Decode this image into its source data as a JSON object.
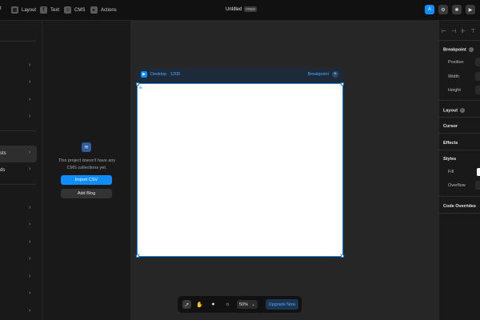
{
  "topbar": {
    "left_cut": "t",
    "items": [
      {
        "label": "Layout",
        "icon": "layout-icon"
      },
      {
        "label": "Text",
        "icon": "text-icon"
      },
      {
        "label": "CMS",
        "icon": "cms-icon"
      },
      {
        "label": "Actions",
        "icon": "actions-icon"
      }
    ],
    "title": "Untitled",
    "plan_badge": "FREE",
    "avatar_initial": "A",
    "accent": "#0f8cff"
  },
  "leftnav": {
    "active_item": "sts",
    "second_item": "ds"
  },
  "cms": {
    "empty_message": "This project doesn't have any CMS collections yet.",
    "import_label": "Import CSV",
    "add_blog_label": "Add Blog"
  },
  "canvas": {
    "frame_label": "Desktop",
    "frame_width": "1200",
    "breakpoint_label": "Breakpoint",
    "plus": "+"
  },
  "bottombar": {
    "zoom": "50%",
    "upgrade_label": "Upgrade Now"
  },
  "inspector": {
    "breakpoint": "Breakpoint",
    "position": "Position",
    "width": "Width",
    "height": "Height",
    "layout": "Layout",
    "cursor": "Cursor",
    "effects": "Effects",
    "styles": "Styles",
    "fill": "Fill",
    "overflow": "Overflow",
    "code_overrides": "Code Overrides"
  }
}
